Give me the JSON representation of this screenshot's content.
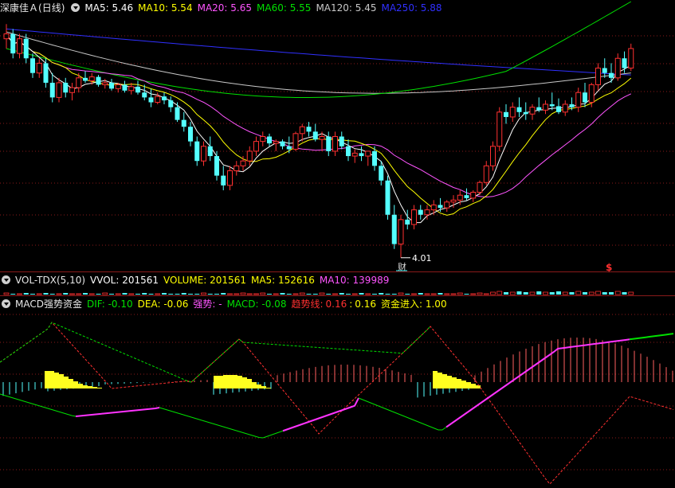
{
  "header_main": {
    "stock": "深康佳Ａ",
    "period": "(日线)",
    "ma5": "MA5: 5.46",
    "ma10": "MA10: 5.54",
    "ma20": "MA20: 5.65",
    "ma60": "MA60: 5.55",
    "ma120": "MA120: 5.45",
    "ma250": "MA250: 5.88"
  },
  "header_vol": {
    "name": "VOL-TDX(5,10)",
    "vvol": "VVOL: 201561",
    "volume": "VOLUME: 201561",
    "ma5": "MA5: 152616",
    "ma10": "MA10: 139989"
  },
  "header_macd": {
    "name": "MACD强势资金",
    "dif": "DIF: -0.10",
    "dea": "DEA: -0.06",
    "qiangshi": "强势: -",
    "macd": "MACD: -0.08",
    "trend_label": "趋势线:",
    "trend_value1": "0.16",
    "trend_sep": ":",
    "trend_value2": "0.16",
    "inflow": "资金进入: 1.00"
  },
  "annotations": {
    "low_price": "4.01",
    "cai_marker": "财",
    "dollar_marker": "$"
  },
  "colors": {
    "up": "#ff3030",
    "down": "#54ffff",
    "ma5": "#ffffff",
    "ma10": "#ffff00",
    "ma20": "#ff55ff",
    "ma60": "#00e000",
    "ma120": "#c8c8c8",
    "ma250": "#3030ff",
    "histogram_yellow": "#ffff20",
    "grid": "#8a1a1a"
  },
  "chart_data": {
    "type": "candlestick",
    "ylim": [
      4.0,
      6.5
    ],
    "candles": [
      [
        6.25,
        6.4,
        6.15,
        6.3
      ],
      [
        6.3,
        6.35,
        6.05,
        6.1
      ],
      [
        6.1,
        6.3,
        6.05,
        6.25
      ],
      [
        6.25,
        6.3,
        6.0,
        6.05
      ],
      [
        6.05,
        6.1,
        5.85,
        5.9
      ],
      [
        5.9,
        6.05,
        5.85,
        6.0
      ],
      [
        6.0,
        6.05,
        5.75,
        5.8
      ],
      [
        5.8,
        5.9,
        5.6,
        5.65
      ],
      [
        5.65,
        5.85,
        5.6,
        5.8
      ],
      [
        5.8,
        5.85,
        5.65,
        5.7
      ],
      [
        5.7,
        5.8,
        5.62,
        5.75
      ],
      [
        5.75,
        5.9,
        5.7,
        5.85
      ],
      [
        5.85,
        5.92,
        5.8,
        5.82
      ],
      [
        5.82,
        5.9,
        5.78,
        5.86
      ],
      [
        5.86,
        5.88,
        5.76,
        5.78
      ],
      [
        5.78,
        5.84,
        5.74,
        5.8
      ],
      [
        5.8,
        5.84,
        5.72,
        5.74
      ],
      [
        5.74,
        5.8,
        5.7,
        5.78
      ],
      [
        5.78,
        5.82,
        5.7,
        5.72
      ],
      [
        5.72,
        5.8,
        5.68,
        5.76
      ],
      [
        5.76,
        5.82,
        5.68,
        5.7
      ],
      [
        5.7,
        5.78,
        5.62,
        5.65
      ],
      [
        5.65,
        5.74,
        5.55,
        5.6
      ],
      [
        5.6,
        5.7,
        5.58,
        5.66
      ],
      [
        5.66,
        5.7,
        5.58,
        5.62
      ],
      [
        5.62,
        5.66,
        5.5,
        5.55
      ],
      [
        5.55,
        5.6,
        5.4,
        5.42
      ],
      [
        5.42,
        5.5,
        5.3,
        5.35
      ],
      [
        5.35,
        5.4,
        5.15,
        5.2
      ],
      [
        5.2,
        5.25,
        4.95,
        5.0
      ],
      [
        5.0,
        5.2,
        4.95,
        5.15
      ],
      [
        5.15,
        5.25,
        5.0,
        5.05
      ],
      [
        5.05,
        5.1,
        4.8,
        4.85
      ],
      [
        4.85,
        4.95,
        4.7,
        4.75
      ],
      [
        4.75,
        4.95,
        4.7,
        4.9
      ],
      [
        4.9,
        5.0,
        4.85,
        4.95
      ],
      [
        4.95,
        5.05,
        4.9,
        5.0
      ],
      [
        5.0,
        5.15,
        4.95,
        5.1
      ],
      [
        5.1,
        5.25,
        5.05,
        5.2
      ],
      [
        5.2,
        5.3,
        5.15,
        5.25
      ],
      [
        5.25,
        5.28,
        5.15,
        5.18
      ],
      [
        5.18,
        5.22,
        5.1,
        5.2
      ],
      [
        5.2,
        5.22,
        5.12,
        5.15
      ],
      [
        5.15,
        5.25,
        5.08,
        5.12
      ],
      [
        5.12,
        5.3,
        5.1,
        5.28
      ],
      [
        5.28,
        5.38,
        5.2,
        5.35
      ],
      [
        5.35,
        5.4,
        5.25,
        5.3
      ],
      [
        5.3,
        5.38,
        5.2,
        5.22
      ],
      [
        5.22,
        5.3,
        5.1,
        5.25
      ],
      [
        5.25,
        5.3,
        5.05,
        5.1
      ],
      [
        5.1,
        5.3,
        5.05,
        5.25
      ],
      [
        5.25,
        5.3,
        5.12,
        5.15
      ],
      [
        5.15,
        5.22,
        5.0,
        5.05
      ],
      [
        5.05,
        5.12,
        4.98,
        5.08
      ],
      [
        5.08,
        5.15,
        5.0,
        5.05
      ],
      [
        5.05,
        5.1,
        4.95,
        5.1
      ],
      [
        5.1,
        5.15,
        4.9,
        4.95
      ],
      [
        4.95,
        5.0,
        4.75,
        4.8
      ],
      [
        4.8,
        4.85,
        4.4,
        4.45
      ],
      [
        4.45,
        4.55,
        4.1,
        4.15
      ],
      [
        4.15,
        4.45,
        4.01,
        4.4
      ],
      [
        4.4,
        4.5,
        4.3,
        4.35
      ],
      [
        4.35,
        4.55,
        4.3,
        4.5
      ],
      [
        4.5,
        4.55,
        4.4,
        4.45
      ],
      [
        4.45,
        4.55,
        4.4,
        4.5
      ],
      [
        4.5,
        4.6,
        4.45,
        4.55
      ],
      [
        4.55,
        4.62,
        4.48,
        4.52
      ],
      [
        4.52,
        4.6,
        4.48,
        4.58
      ],
      [
        4.58,
        4.65,
        4.52,
        4.6
      ],
      [
        4.6,
        4.7,
        4.55,
        4.65
      ],
      [
        4.65,
        4.72,
        4.6,
        4.62
      ],
      [
        4.62,
        4.7,
        4.58,
        4.68
      ],
      [
        4.68,
        4.8,
        4.65,
        4.78
      ],
      [
        4.78,
        5.0,
        4.75,
        4.95
      ],
      [
        4.95,
        5.2,
        4.9,
        5.15
      ],
      [
        5.15,
        5.55,
        5.1,
        5.5
      ],
      [
        5.5,
        5.58,
        5.38,
        5.45
      ],
      [
        5.45,
        5.6,
        5.4,
        5.55
      ],
      [
        5.55,
        5.65,
        5.45,
        5.5
      ],
      [
        5.5,
        5.6,
        5.42,
        5.48
      ],
      [
        5.48,
        5.58,
        5.42,
        5.55
      ],
      [
        5.55,
        5.65,
        5.5,
        5.52
      ],
      [
        5.52,
        5.62,
        5.48,
        5.58
      ],
      [
        5.58,
        5.7,
        5.52,
        5.56
      ],
      [
        5.56,
        5.64,
        5.48,
        5.5
      ],
      [
        5.5,
        5.62,
        5.46,
        5.58
      ],
      [
        5.58,
        5.65,
        5.52,
        5.55
      ],
      [
        5.55,
        5.75,
        5.5,
        5.7
      ],
      [
        5.7,
        5.8,
        5.55,
        5.6
      ],
      [
        5.6,
        5.8,
        5.55,
        5.78
      ],
      [
        5.78,
        6.0,
        5.72,
        5.95
      ],
      [
        5.95,
        6.05,
        5.85,
        5.9
      ],
      [
        5.9,
        6.0,
        5.8,
        5.85
      ],
      [
        5.85,
        6.1,
        5.82,
        6.05
      ],
      [
        6.05,
        6.12,
        5.9,
        5.95
      ],
      [
        5.95,
        6.2,
        5.92,
        6.15
      ]
    ],
    "ma_values": {
      "MA5": 5.46,
      "MA10": 5.54,
      "MA20": 5.65,
      "MA60": 5.55,
      "MA120": 5.45,
      "MA250": 5.88
    },
    "macd": {
      "DIF": -0.1,
      "DEA": -0.06,
      "MACD": -0.08,
      "trend": 0.16,
      "inflow": 1.0
    }
  }
}
